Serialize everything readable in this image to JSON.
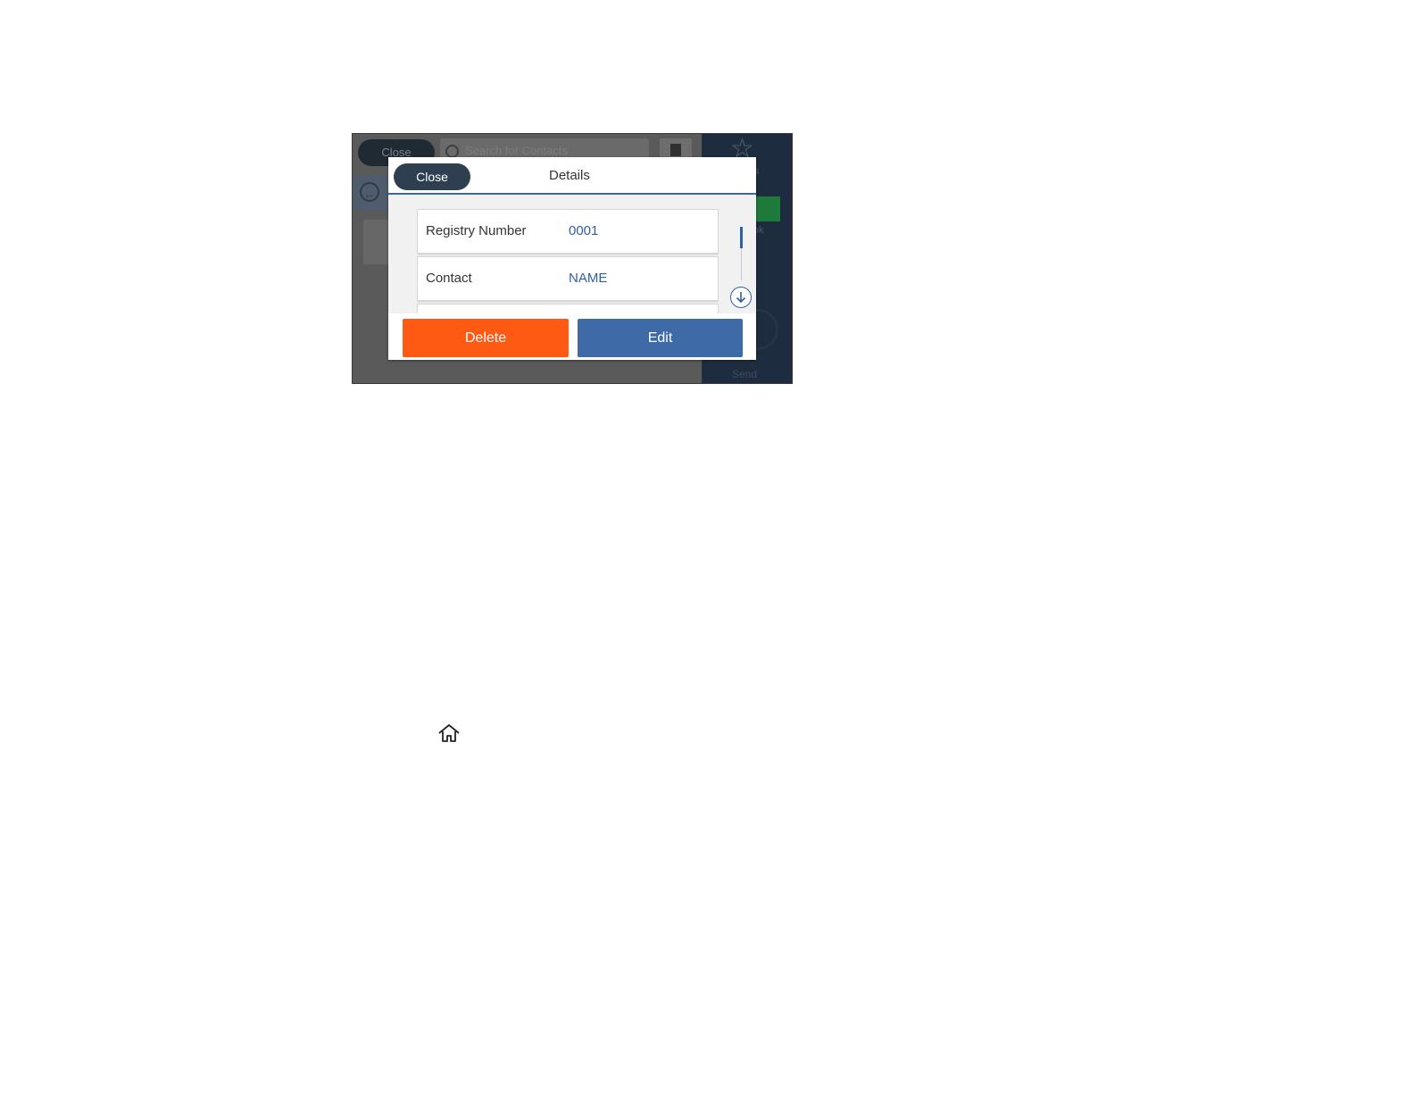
{
  "background": {
    "close_label": "Close",
    "search_placeholder": "Search for Contacts",
    "send_label": "Send"
  },
  "dialog": {
    "close_label": "Close",
    "title": "Details",
    "items": [
      {
        "label": "Registry Number",
        "value": "0001"
      },
      {
        "label": "Contact",
        "value": "NAME"
      }
    ],
    "delete_label": "Delete",
    "edit_label": "Edit"
  },
  "colors": {
    "delete": "#ff5a14",
    "edit": "#3f6aa8",
    "header_accent": "#3a66a8",
    "close_button": "#2e3f52"
  },
  "icons": [
    "search-icon",
    "address-book-icon",
    "back-arrow-icon",
    "star-icon",
    "scroll-down-icon",
    "home-icon"
  ]
}
